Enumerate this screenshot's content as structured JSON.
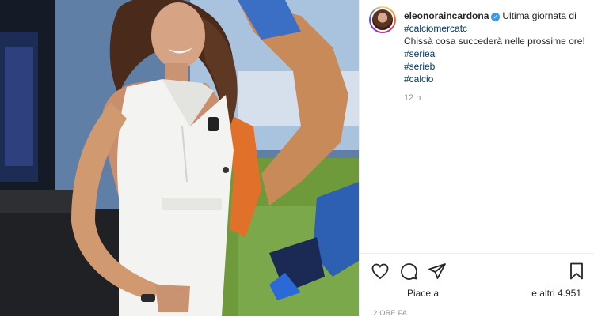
{
  "post": {
    "username": "eleonoraincardona",
    "verified_mark": "✓",
    "caption_intro": "Ultima giornata di ",
    "caption_tag": "#calciomercatc",
    "caption_rest": "Chissà cosa succederà nelle prossime ore!",
    "hashtags": [
      "#seriea",
      "#serieb",
      "#calcio"
    ],
    "time_ago": "12 h",
    "likes_prefix": "Piace a",
    "likes_suffix": "e altri 4.951",
    "timestamp": "12 ORE FA"
  },
  "icons": {
    "like": "heart-icon",
    "comment": "comment-icon",
    "share": "share-icon",
    "save": "bookmark-icon"
  },
  "colors": {
    "hashtag": "#00376b",
    "text": "#262626",
    "secondary": "#8e8e8e",
    "verified": "#3897f0"
  }
}
